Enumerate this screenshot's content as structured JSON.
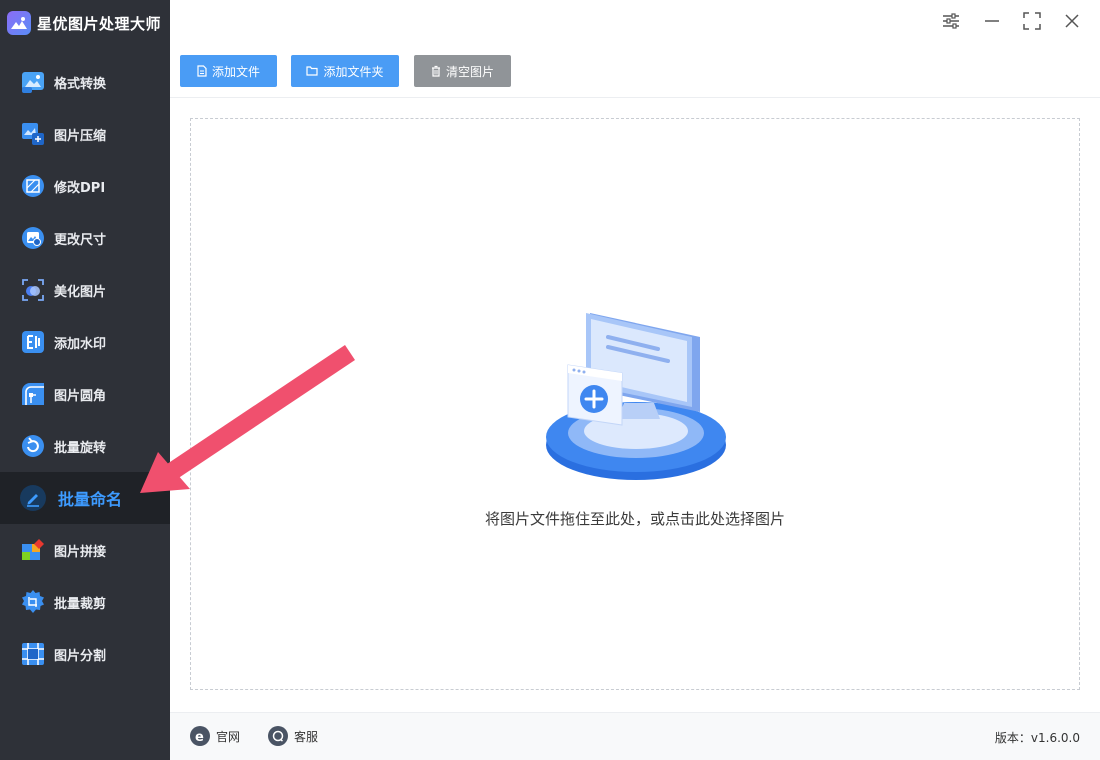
{
  "app": {
    "title": "星优图片处理大师"
  },
  "sidebar": {
    "items": [
      {
        "label": "格式转换",
        "icon": "image-convert-icon",
        "active": false
      },
      {
        "label": "图片压缩",
        "icon": "image-compress-icon",
        "active": false
      },
      {
        "label": "修改DPI",
        "icon": "dpi-icon",
        "active": false
      },
      {
        "label": "更改尺寸",
        "icon": "resize-icon",
        "active": false
      },
      {
        "label": "美化图片",
        "icon": "beautify-icon",
        "active": false
      },
      {
        "label": "添加水印",
        "icon": "watermark-icon",
        "active": false
      },
      {
        "label": "图片圆角",
        "icon": "rounded-corner-icon",
        "active": false
      },
      {
        "label": "批量旋转",
        "icon": "rotate-icon",
        "active": false
      },
      {
        "label": "批量命名",
        "icon": "rename-icon",
        "active": true
      },
      {
        "label": "图片拼接",
        "icon": "collage-icon",
        "active": false
      },
      {
        "label": "批量裁剪",
        "icon": "crop-icon",
        "active": false
      },
      {
        "label": "图片分割",
        "icon": "split-icon",
        "active": false
      }
    ]
  },
  "toolbar": {
    "add_file": "添加文件",
    "add_folder": "添加文件夹",
    "clear_images": "清空图片"
  },
  "dropzone": {
    "text": "将图片文件拖住至此处，或点击此处选择图片"
  },
  "footer": {
    "website": "官网",
    "support": "客服",
    "version": "版本：v1.6.0.0"
  },
  "colors": {
    "sidebar_bg": "#2e3138",
    "active_item_bg": "#1f2227",
    "active_label": "#3d9bff",
    "primary_button": "#4a9cf5",
    "secondary_button": "#909498",
    "annotation_arrow": "#f0506e"
  }
}
